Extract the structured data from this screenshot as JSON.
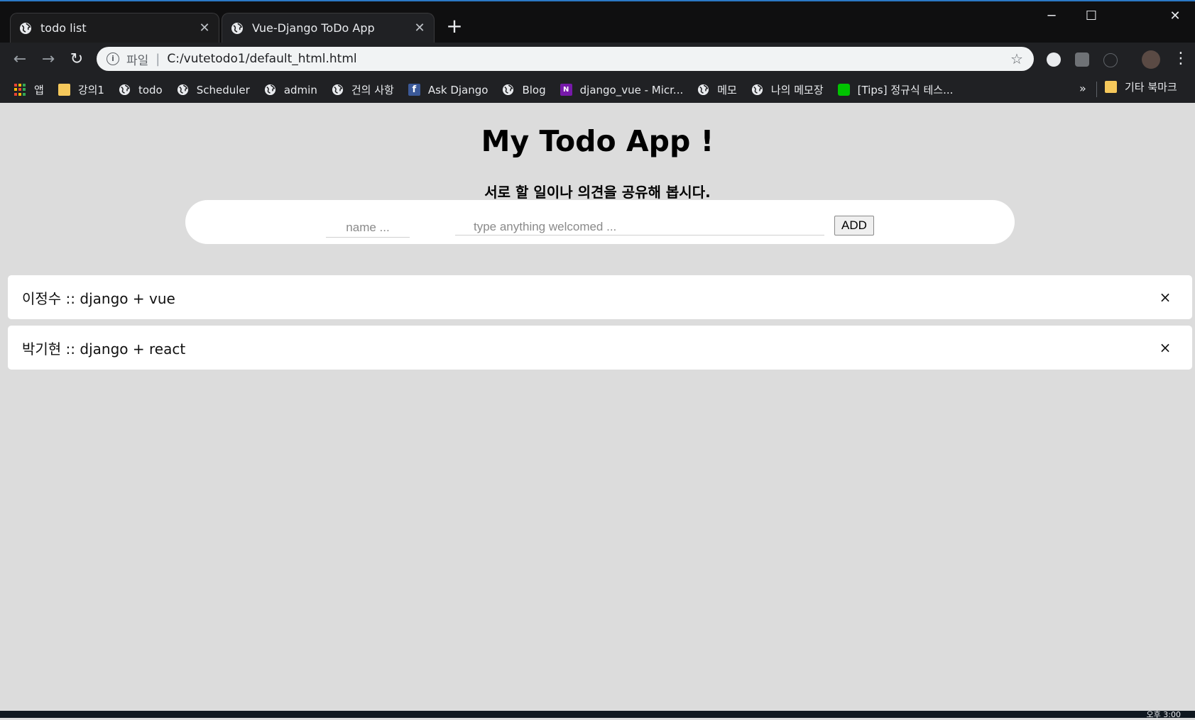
{
  "browser": {
    "tabs": [
      {
        "label": "todo list",
        "active": false
      },
      {
        "label": "Vue-Django ToDo App",
        "active": true
      }
    ],
    "new_tab_label": "+",
    "window_controls": {
      "minimize": "─",
      "maximize": "☐",
      "close": "✕"
    },
    "address": {
      "scheme_label": "파일",
      "separator": "|",
      "url": "C:/vutetodo1/default_html.html"
    },
    "bookmarks": [
      {
        "label": "앱",
        "icon": "apps-icon"
      },
      {
        "label": "강의1",
        "icon": "folder-icon"
      },
      {
        "label": "todo",
        "icon": "globe-icon"
      },
      {
        "label": "Scheduler",
        "icon": "globe-icon"
      },
      {
        "label": "admin",
        "icon": "globe-icon"
      },
      {
        "label": "건의 사항",
        "icon": "globe-icon"
      },
      {
        "label": "Ask Django",
        "icon": "facebook-icon"
      },
      {
        "label": "Blog",
        "icon": "globe-icon"
      },
      {
        "label": "django_vue - Micr...",
        "icon": "onenote-icon"
      },
      {
        "label": "메모",
        "icon": "globe-icon"
      },
      {
        "label": "나의 메모장",
        "icon": "globe-icon"
      },
      {
        "label": "[Tips] 정규식 테스...",
        "icon": "line-icon"
      }
    ],
    "bookmarks_overflow": "»",
    "other_bookmarks": "기타 북마크"
  },
  "app": {
    "title": "My Todo App !",
    "subtitle": "서로 할 일이나 의견을 공유해 봅시다.",
    "form": {
      "name_placeholder": "name ...",
      "body_placeholder": "type anything welcomed ...",
      "add_label": "ADD"
    },
    "todos": [
      {
        "text": "이정수 :: django + vue",
        "remove_label": "×"
      },
      {
        "text": "박기현 :: django + react",
        "remove_label": "×"
      }
    ]
  },
  "taskbar": {
    "clock": "오후 3:00"
  },
  "colors": {
    "chrome_bg": "#202124",
    "tabstrip_bg": "#0f0f10",
    "page_bg": "#dcdcdc",
    "card_bg": "#ffffff"
  }
}
